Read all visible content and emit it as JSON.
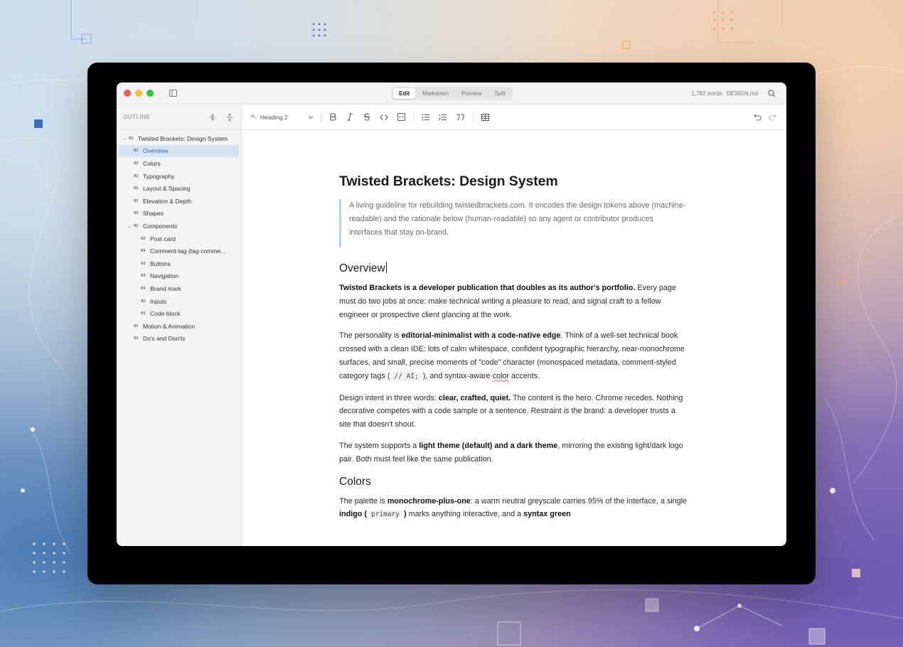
{
  "window": {
    "modes": [
      "Edit",
      "Markdown",
      "Preview",
      "Split"
    ],
    "active_mode": "Edit",
    "word_count": "1,782 words",
    "filename": "DESIGN.md"
  },
  "sidebar": {
    "header": "OUTLINE",
    "items": [
      {
        "level": "H1",
        "label": "Twisted Brackets: Design System",
        "expanded": true
      },
      {
        "level": "H2",
        "label": "Overview",
        "active": true
      },
      {
        "level": "H2",
        "label": "Colors"
      },
      {
        "level": "H2",
        "label": "Typography"
      },
      {
        "level": "H2",
        "label": "Layout & Spacing"
      },
      {
        "level": "H2",
        "label": "Elevation & Depth"
      },
      {
        "level": "H2",
        "label": "Shapes"
      },
      {
        "level": "H2",
        "label": "Components",
        "expanded": true
      },
      {
        "level": "H3",
        "label": "Post card"
      },
      {
        "level": "H3",
        "label": "Comment-tag (tag-comme..."
      },
      {
        "level": "H3",
        "label": "Buttons"
      },
      {
        "level": "H3",
        "label": "Navigation"
      },
      {
        "level": "H3",
        "label": "Brand mark"
      },
      {
        "level": "H3",
        "label": "Inputs"
      },
      {
        "level": "H3",
        "label": "Code block"
      },
      {
        "level": "H2",
        "label": "Motion & Animation"
      },
      {
        "level": "H2",
        "label": "Do's and Don'ts"
      }
    ]
  },
  "toolbar": {
    "heading_icon": "H₂",
    "heading_value": "Heading 2"
  },
  "doc": {
    "title": "Twisted Brackets: Design System",
    "quote": "A living guideline for rebuilding twistedbrackets.com. It encodes the design tokens above (machine-readable) and the rationale below (human-readable) so any agent or contributor produces interfaces that stay on-brand.",
    "h2_overview": "Overview",
    "p1_bold": "Twisted Brackets is a developer publication that doubles as its author's portfolio.",
    "p1_rest": " Every page must do two jobs at once: make technical writing a pleasure to read, and signal craft to a fellow engineer or prospective client glancing at the work.",
    "p2_a": "The personality is ",
    "p2_b": "editorial-minimalist with a code-native edge",
    "p2_c": ". Think of a well-set technical book crossed with a clean IDE: lots of calm whitespace, confident typographic hierarchy, near-monochrome surfaces, and small, precise moments of \"code\" character (monospaced metadata, comment-styled category tags (",
    "p2_code": "// AI;",
    "p2_d": "), and syntax-aware ",
    "p2_e": "color",
    "p2_f": " accents.",
    "p3_a": "Design intent in three words: ",
    "p3_b": "clear, crafted, quiet.",
    "p3_c": " The content is the hero. Chrome recedes. Nothing decorative competes with a code sample or a sentence. Restraint ",
    "p3_d": "is",
    "p3_e": " the brand: a developer trusts a site that doesn't shout.",
    "p4_a": "The system supports a ",
    "p4_b": "light theme (default) and a dark theme",
    "p4_c": ", mirroring the existing light/dark logo pair. Both must feel like the same publication.",
    "h2_colors": "Colors",
    "p5_a": "The palette is ",
    "p5_b": "monochrome-plus-one",
    "p5_c": ": a warm neutral greyscale carries 95% of the interface, a single ",
    "p5_d": "indigo (",
    "p5_code": "primary",
    "p5_e": ")",
    "p5_f": " marks anything interactive, and a ",
    "p5_g": "syntax green"
  }
}
